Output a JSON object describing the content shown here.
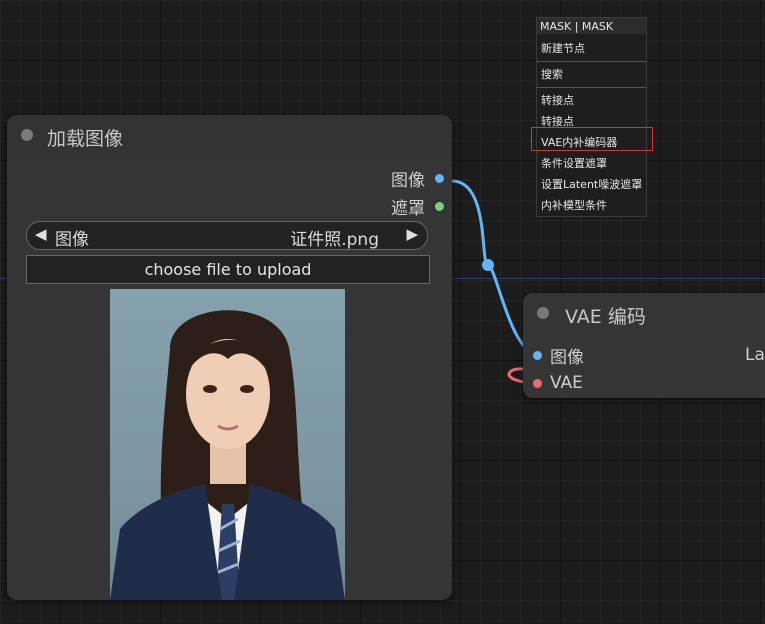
{
  "load_image_node": {
    "title": "加载图像",
    "outputs": [
      "图像",
      "遮罩"
    ],
    "combo_label": "图像",
    "combo_value": "证件照.png",
    "upload_label": "choose file to upload"
  },
  "vae_encode_node": {
    "title": "VAE 编码",
    "inputs": [
      "图像",
      "VAE"
    ],
    "output_partial": "La"
  },
  "context_menu": {
    "title": "MASK | MASK",
    "items": [
      "新建节点",
      "搜索",
      "转接点",
      "转接点",
      "VAE内补编码器",
      "条件设置遮罩",
      "设置Latent噪波遮罩",
      "内补模型条件"
    ],
    "highlighted_item": "VAE内补编码器"
  },
  "colors": {
    "image_slot": "#64b5f6",
    "mask_slot": "#7ccf7c",
    "vae_slot": "#ef6b6b",
    "highlight": "#d0393b"
  },
  "icons": {
    "combo_left": "◀",
    "combo_right": "▶"
  }
}
